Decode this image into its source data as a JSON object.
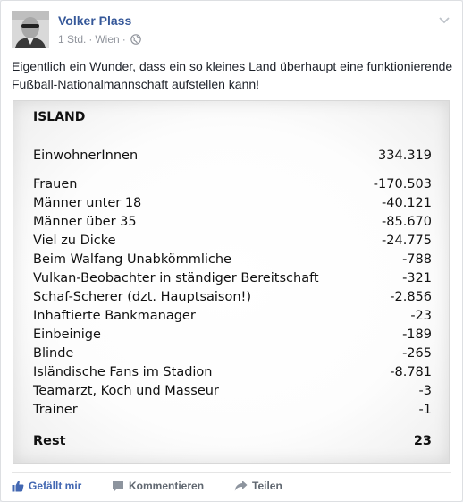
{
  "post": {
    "author": "Volker Plass",
    "time": "1 Std.",
    "location": "Wien",
    "text": "Eigentlich ein Wunder, dass ein so kleines Land überhaupt eine funktionierende Fußball-Nationalmannschaft aufstellen kann!"
  },
  "table": {
    "title": "ISLAND",
    "population": {
      "label": "EinwohnerInnen",
      "value": "334.319"
    },
    "rows": [
      {
        "label": "Frauen",
        "value": "-170.503"
      },
      {
        "label": "Männer unter 18",
        "value": "-40.121"
      },
      {
        "label": "Männer über 35",
        "value": "-85.670"
      },
      {
        "label": "Viel zu Dicke",
        "value": "-24.775"
      },
      {
        "label": "Beim Walfang Unabkömmliche",
        "value": "-788"
      },
      {
        "label": "Vulkan-Beobachter in ständiger Bereitschaft",
        "value": "-321"
      },
      {
        "label": "Schaf-Scherer (dzt. Hauptsaison!)",
        "value": "-2.856"
      },
      {
        "label": "Inhaftierte Bankmanager",
        "value": "-23"
      },
      {
        "label": "Einbeinige",
        "value": "-189"
      },
      {
        "label": "Blinde",
        "value": "-265"
      },
      {
        "label": "Isländische Fans im Stadion",
        "value": "-8.781"
      },
      {
        "label": "Teamarzt, Koch und Masseur",
        "value": "-3"
      },
      {
        "label": "Trainer",
        "value": "-1"
      }
    ],
    "rest": {
      "label": "Rest",
      "value": "23"
    }
  },
  "actions": {
    "like": "Gefällt mir",
    "comment": "Kommentieren",
    "share": "Teilen"
  },
  "colors": {
    "link": "#365899",
    "like": "#4267b2",
    "muted": "#90949c"
  },
  "icons": {
    "avatar": "avatar",
    "audience": "globe-icon",
    "menu": "chevron-down-icon",
    "like": "thumbs-up-icon",
    "comment": "comment-icon",
    "share": "share-icon"
  }
}
